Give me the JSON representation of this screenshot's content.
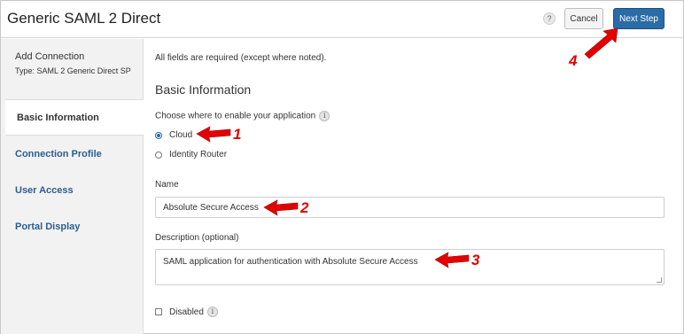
{
  "header": {
    "title": "Generic SAML 2 Direct",
    "help_label": "?",
    "cancel_label": "Cancel",
    "next_label": "Next Step"
  },
  "sidebar": {
    "title": "Add Connection",
    "subtitle": "Type: SAML 2 Generic Direct SP",
    "items": [
      {
        "label": "Basic Information",
        "active": true
      },
      {
        "label": "Connection Profile",
        "active": false
      },
      {
        "label": "User Access",
        "active": false
      },
      {
        "label": "Portal Display",
        "active": false
      }
    ]
  },
  "main": {
    "note": "All fields are required (except where noted).",
    "section_title": "Basic Information",
    "enable_label": "Choose where to enable your application",
    "info_glyph": "i",
    "options": [
      {
        "label": "Cloud",
        "selected": true
      },
      {
        "label": "Identity Router",
        "selected": false
      }
    ],
    "name_label": "Name",
    "name_value": "Absolute Secure Access",
    "description_label": "Description (optional)",
    "description_value": "SAML application for authentication with Absolute Secure Access",
    "disabled_label": "Disabled",
    "disabled_checked": false
  },
  "annotations": [
    "1",
    "2",
    "3",
    "4"
  ],
  "colors": {
    "accent": "#2a6ca6",
    "annotation": "#e30000",
    "sidebar_bg": "#f2f2f2"
  }
}
